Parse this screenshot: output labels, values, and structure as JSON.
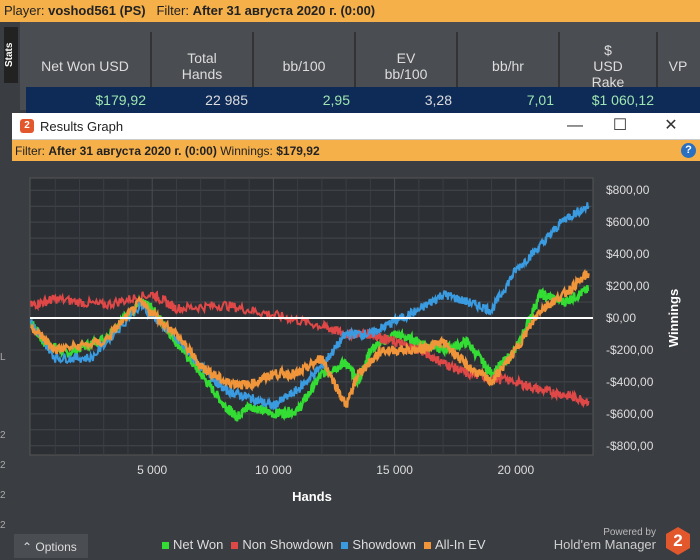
{
  "topbar": {
    "player_label": "Player:",
    "player": "voshod561 (PS)",
    "filter_label": "Filter:",
    "filter": "After 31 августа 2020 г. (0:00)"
  },
  "stats_tab": "Stats",
  "columns": [
    "Net Won USD",
    "Total Hands",
    "bb/100",
    "EV bb/100",
    "bb/hr",
    "$ USD Rake",
    "VP"
  ],
  "values": [
    "$179,92",
    "22 985",
    "2,95",
    "3,28",
    "7,01",
    "$1 060,12",
    ""
  ],
  "window": {
    "title": "Results Graph",
    "logo": "2",
    "minimize": "—",
    "maximize": "☐",
    "close": "✕"
  },
  "filterbar": {
    "filter_label": "Filter:",
    "filter": "After 31 августа 2020 г. (0:00)",
    "winnings_label": "Winnings:",
    "winnings": "$179,92",
    "help": "?"
  },
  "chart_data": {
    "type": "line",
    "xlabel": "Hands",
    "ylabel": "Winnings",
    "xlim": [
      0,
      23000
    ],
    "ylim": [
      -900,
      900
    ],
    "xticks": [
      5000,
      10000,
      15000,
      20000
    ],
    "xtick_labels": [
      "5 000",
      "10 000",
      "15 000",
      "20 000"
    ],
    "yticks": [
      800,
      600,
      400,
      200,
      0,
      -200,
      -400,
      -600,
      -800
    ],
    "ytick_labels": [
      "$800,00",
      "$600,00",
      "$400,00",
      "$200,00",
      "$0,00",
      "-$200,00",
      "-$400,00",
      "-$600,00",
      "-$800,00"
    ],
    "grid": true,
    "legend": "bottom",
    "series": [
      {
        "name": "Net Won",
        "color": "#33dd33",
        "x": [
          0,
          500,
          1500,
          3000,
          4500,
          5000,
          6000,
          7000,
          8000,
          8500,
          9000,
          10000,
          11000,
          12000,
          13000,
          13500,
          14000,
          15000,
          16000,
          17000,
          18000,
          19000,
          20000,
          21000,
          22000,
          23000
        ],
        "y": [
          -20,
          -150,
          -220,
          -130,
          100,
          60,
          -150,
          -350,
          -550,
          -620,
          -550,
          -600,
          -580,
          -350,
          -280,
          -400,
          -200,
          -100,
          -150,
          -200,
          -150,
          -350,
          -200,
          150,
          100,
          180
        ]
      },
      {
        "name": "Non Showdown",
        "color": "#e04848",
        "x": [
          0,
          1000,
          3000,
          5000,
          6000,
          8000,
          10000,
          12000,
          13000,
          14000,
          15000,
          16000,
          17000,
          18000,
          20000,
          21000,
          22000,
          23000
        ],
        "y": [
          80,
          120,
          80,
          150,
          60,
          80,
          20,
          -50,
          -100,
          -100,
          -150,
          -200,
          -280,
          -350,
          -400,
          -450,
          -480,
          -520
        ]
      },
      {
        "name": "Showdown",
        "color": "#3a9be0",
        "x": [
          0,
          1000,
          2500,
          4500,
          5500,
          7000,
          8000,
          9000,
          10000,
          11000,
          12000,
          13000,
          14000,
          15000,
          16000,
          17000,
          18000,
          19000,
          20000,
          21000,
          22000,
          23000
        ],
        "y": [
          -30,
          -250,
          -250,
          80,
          -50,
          -300,
          -450,
          -500,
          -550,
          -450,
          -300,
          -100,
          -100,
          -20,
          50,
          150,
          100,
          50,
          300,
          450,
          620,
          700
        ]
      },
      {
        "name": "All-In EV",
        "color": "#f0953a",
        "x": [
          0,
          1000,
          3000,
          4500,
          6000,
          7000,
          8000,
          9000,
          10000,
          11000,
          12000,
          13000,
          13500,
          14500,
          16000,
          17000,
          18000,
          19000,
          20000,
          21000,
          22000,
          23000
        ],
        "y": [
          -50,
          -200,
          -150,
          100,
          -100,
          -300,
          -400,
          -420,
          -350,
          -350,
          -250,
          -550,
          -350,
          -200,
          -200,
          -150,
          -300,
          -400,
          -200,
          50,
          150,
          280
        ]
      }
    ]
  },
  "options": "Options",
  "powered": "Powered by",
  "brand": "Hold'em Manager",
  "brand_logo": "2",
  "side_marks": [
    "L",
    "2",
    "2",
    "2",
    "2",
    "2"
  ]
}
